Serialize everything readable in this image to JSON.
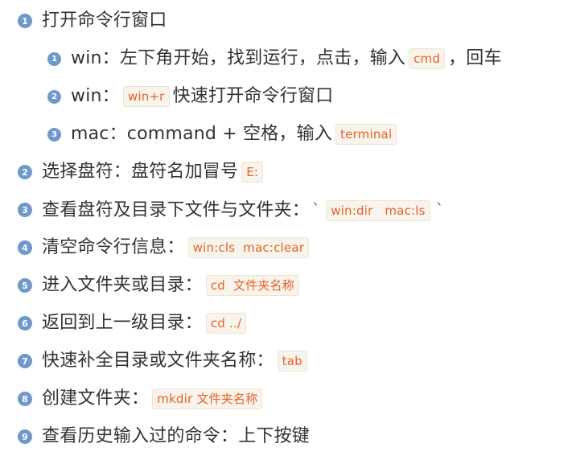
{
  "colors": {
    "badge": "#6f98cc",
    "code_text": "#e4622a",
    "code_bg": "#f8f4ec",
    "text": "#333333"
  },
  "items": [
    {
      "num": "1",
      "text": "打开命令行窗口"
    },
    {
      "num": "1",
      "pre": "win：左下角开始，找到运行，点击，输入",
      "code": "cmd",
      "post": "，回车"
    },
    {
      "num": "2",
      "pre": "win：",
      "code": "win+r",
      "post": "快速打开命令行窗口"
    },
    {
      "num": "3",
      "pre": "mac：command + 空格，输入",
      "code": "terminal"
    },
    {
      "num": "2",
      "pre": "选择盘符：盘符名加冒号",
      "code": "E:"
    },
    {
      "num": "3",
      "pre": "查看盘符及目录下文件与文件夹：",
      "tick": "`",
      "code": "win:dir   mac:ls",
      "tick_end": "`"
    },
    {
      "num": "4",
      "pre": "清空命令行信息：",
      "code": "win:cls  mac:clear"
    },
    {
      "num": "5",
      "pre": "进入文件夹或目录：",
      "code": "cd  文件夹名称"
    },
    {
      "num": "6",
      "pre": "返回到上一级目录：",
      "code": "cd ../"
    },
    {
      "num": "7",
      "pre": "快速补全目录或文件夹名称：",
      "code": "tab"
    },
    {
      "num": "8",
      "pre": "创建文件夹：",
      "code": "mkdir 文件夹名称"
    },
    {
      "num": "9",
      "text": "查看历史输入过的命令：上下按键"
    }
  ]
}
